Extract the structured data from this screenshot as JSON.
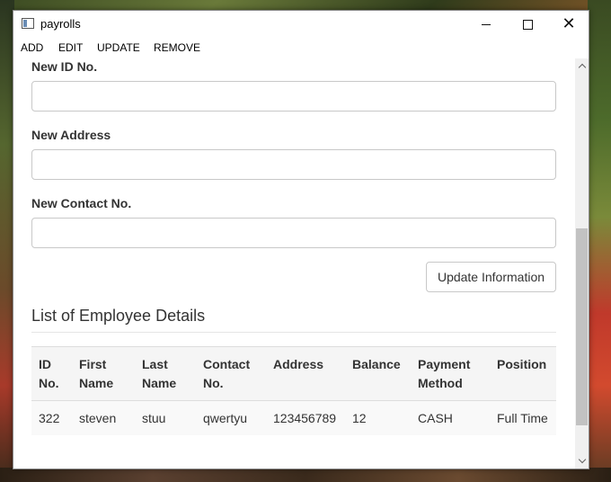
{
  "window": {
    "title": "payrolls"
  },
  "menu": {
    "items": [
      "ADD",
      "EDIT",
      "UPDATE",
      "REMOVE"
    ]
  },
  "form": {
    "id_label": "New ID No.",
    "id_value": "",
    "address_label": "New Address",
    "address_value": "",
    "contact_label": "New Contact No.",
    "contact_value": "",
    "update_button": "Update Information"
  },
  "list": {
    "title": "List of Employee Details",
    "columns": [
      "ID No.",
      "First Name",
      "Last Name",
      "Contact No.",
      "Address",
      "Balance",
      "Payment Method",
      "Position"
    ],
    "rows": [
      [
        "322",
        "steven",
        "stuu",
        "qwertyu",
        "123456789",
        "12",
        "CASH",
        "Full Time"
      ]
    ]
  }
}
